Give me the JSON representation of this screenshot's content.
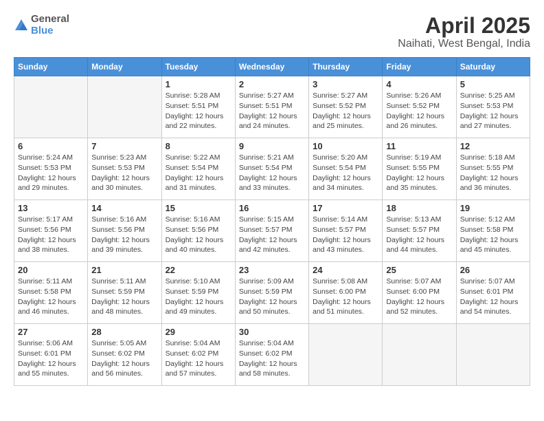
{
  "header": {
    "logo_general": "General",
    "logo_blue": "Blue",
    "month": "April 2025",
    "location": "Naihati, West Bengal, India"
  },
  "weekdays": [
    "Sunday",
    "Monday",
    "Tuesday",
    "Wednesday",
    "Thursday",
    "Friday",
    "Saturday"
  ],
  "weeks": [
    [
      {
        "day": "",
        "sunrise": "",
        "sunset": "",
        "daylight": ""
      },
      {
        "day": "",
        "sunrise": "",
        "sunset": "",
        "daylight": ""
      },
      {
        "day": "1",
        "sunrise": "Sunrise: 5:28 AM",
        "sunset": "Sunset: 5:51 PM",
        "daylight": "Daylight: 12 hours and 22 minutes."
      },
      {
        "day": "2",
        "sunrise": "Sunrise: 5:27 AM",
        "sunset": "Sunset: 5:51 PM",
        "daylight": "Daylight: 12 hours and 24 minutes."
      },
      {
        "day": "3",
        "sunrise": "Sunrise: 5:27 AM",
        "sunset": "Sunset: 5:52 PM",
        "daylight": "Daylight: 12 hours and 25 minutes."
      },
      {
        "day": "4",
        "sunrise": "Sunrise: 5:26 AM",
        "sunset": "Sunset: 5:52 PM",
        "daylight": "Daylight: 12 hours and 26 minutes."
      },
      {
        "day": "5",
        "sunrise": "Sunrise: 5:25 AM",
        "sunset": "Sunset: 5:53 PM",
        "daylight": "Daylight: 12 hours and 27 minutes."
      }
    ],
    [
      {
        "day": "6",
        "sunrise": "Sunrise: 5:24 AM",
        "sunset": "Sunset: 5:53 PM",
        "daylight": "Daylight: 12 hours and 29 minutes."
      },
      {
        "day": "7",
        "sunrise": "Sunrise: 5:23 AM",
        "sunset": "Sunset: 5:53 PM",
        "daylight": "Daylight: 12 hours and 30 minutes."
      },
      {
        "day": "8",
        "sunrise": "Sunrise: 5:22 AM",
        "sunset": "Sunset: 5:54 PM",
        "daylight": "Daylight: 12 hours and 31 minutes."
      },
      {
        "day": "9",
        "sunrise": "Sunrise: 5:21 AM",
        "sunset": "Sunset: 5:54 PM",
        "daylight": "Daylight: 12 hours and 33 minutes."
      },
      {
        "day": "10",
        "sunrise": "Sunrise: 5:20 AM",
        "sunset": "Sunset: 5:54 PM",
        "daylight": "Daylight: 12 hours and 34 minutes."
      },
      {
        "day": "11",
        "sunrise": "Sunrise: 5:19 AM",
        "sunset": "Sunset: 5:55 PM",
        "daylight": "Daylight: 12 hours and 35 minutes."
      },
      {
        "day": "12",
        "sunrise": "Sunrise: 5:18 AM",
        "sunset": "Sunset: 5:55 PM",
        "daylight": "Daylight: 12 hours and 36 minutes."
      }
    ],
    [
      {
        "day": "13",
        "sunrise": "Sunrise: 5:17 AM",
        "sunset": "Sunset: 5:56 PM",
        "daylight": "Daylight: 12 hours and 38 minutes."
      },
      {
        "day": "14",
        "sunrise": "Sunrise: 5:16 AM",
        "sunset": "Sunset: 5:56 PM",
        "daylight": "Daylight: 12 hours and 39 minutes."
      },
      {
        "day": "15",
        "sunrise": "Sunrise: 5:16 AM",
        "sunset": "Sunset: 5:56 PM",
        "daylight": "Daylight: 12 hours and 40 minutes."
      },
      {
        "day": "16",
        "sunrise": "Sunrise: 5:15 AM",
        "sunset": "Sunset: 5:57 PM",
        "daylight": "Daylight: 12 hours and 42 minutes."
      },
      {
        "day": "17",
        "sunrise": "Sunrise: 5:14 AM",
        "sunset": "Sunset: 5:57 PM",
        "daylight": "Daylight: 12 hours and 43 minutes."
      },
      {
        "day": "18",
        "sunrise": "Sunrise: 5:13 AM",
        "sunset": "Sunset: 5:57 PM",
        "daylight": "Daylight: 12 hours and 44 minutes."
      },
      {
        "day": "19",
        "sunrise": "Sunrise: 5:12 AM",
        "sunset": "Sunset: 5:58 PM",
        "daylight": "Daylight: 12 hours and 45 minutes."
      }
    ],
    [
      {
        "day": "20",
        "sunrise": "Sunrise: 5:11 AM",
        "sunset": "Sunset: 5:58 PM",
        "daylight": "Daylight: 12 hours and 46 minutes."
      },
      {
        "day": "21",
        "sunrise": "Sunrise: 5:11 AM",
        "sunset": "Sunset: 5:59 PM",
        "daylight": "Daylight: 12 hours and 48 minutes."
      },
      {
        "day": "22",
        "sunrise": "Sunrise: 5:10 AM",
        "sunset": "Sunset: 5:59 PM",
        "daylight": "Daylight: 12 hours and 49 minutes."
      },
      {
        "day": "23",
        "sunrise": "Sunrise: 5:09 AM",
        "sunset": "Sunset: 5:59 PM",
        "daylight": "Daylight: 12 hours and 50 minutes."
      },
      {
        "day": "24",
        "sunrise": "Sunrise: 5:08 AM",
        "sunset": "Sunset: 6:00 PM",
        "daylight": "Daylight: 12 hours and 51 minutes."
      },
      {
        "day": "25",
        "sunrise": "Sunrise: 5:07 AM",
        "sunset": "Sunset: 6:00 PM",
        "daylight": "Daylight: 12 hours and 52 minutes."
      },
      {
        "day": "26",
        "sunrise": "Sunrise: 5:07 AM",
        "sunset": "Sunset: 6:01 PM",
        "daylight": "Daylight: 12 hours and 54 minutes."
      }
    ],
    [
      {
        "day": "27",
        "sunrise": "Sunrise: 5:06 AM",
        "sunset": "Sunset: 6:01 PM",
        "daylight": "Daylight: 12 hours and 55 minutes."
      },
      {
        "day": "28",
        "sunrise": "Sunrise: 5:05 AM",
        "sunset": "Sunset: 6:02 PM",
        "daylight": "Daylight: 12 hours and 56 minutes."
      },
      {
        "day": "29",
        "sunrise": "Sunrise: 5:04 AM",
        "sunset": "Sunset: 6:02 PM",
        "daylight": "Daylight: 12 hours and 57 minutes."
      },
      {
        "day": "30",
        "sunrise": "Sunrise: 5:04 AM",
        "sunset": "Sunset: 6:02 PM",
        "daylight": "Daylight: 12 hours and 58 minutes."
      },
      {
        "day": "",
        "sunrise": "",
        "sunset": "",
        "daylight": ""
      },
      {
        "day": "",
        "sunrise": "",
        "sunset": "",
        "daylight": ""
      },
      {
        "day": "",
        "sunrise": "",
        "sunset": "",
        "daylight": ""
      }
    ]
  ]
}
